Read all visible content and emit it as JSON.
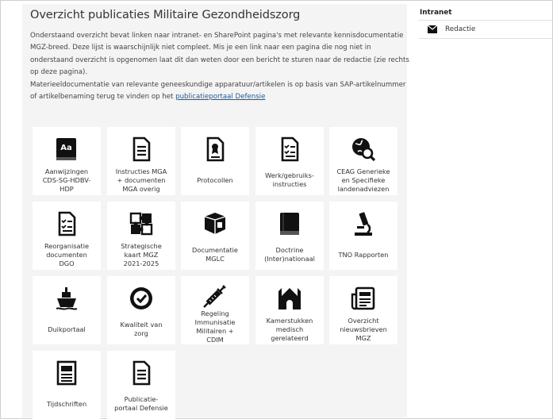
{
  "page": {
    "title": "Overzicht publicaties Militaire Gezondheidszorg",
    "intro_line1": "Onderstaand overzicht bevat linken naar intranet- en SharePoint pagina's met relevante kennisdocumentatie MGZ-breed. Deze lijst is waarschijnlijk niet compleet. Mis je een link naar een pagina die nog niet in onderstaand overzicht is opgenomen laat dit dan weten door een bericht te sturen naar de redactie (zie rechts op deze pagina).",
    "intro_line2": "Materieeldocumentatie van relevante geneeskundige apparatuur/artikelen is op basis van SAP-artikelnummer of artikelbenaming terug te vinden op het ",
    "intro_link": "publicatieportaal Defensie"
  },
  "tiles": [
    {
      "label": "Aanwijzingen\nCDS-SG-HDBV-\nHDP",
      "icon": "book-aa-icon"
    },
    {
      "label": "Instructies MGA\n+ documenten\nMGA overig",
      "icon": "document-icon"
    },
    {
      "label": "Protocollen",
      "icon": "certificate-document-icon"
    },
    {
      "label": "Werk/gebruiks-\ninstructies",
      "icon": "checklist-icon"
    },
    {
      "label": "CEAG Generieke\nen Specifieke\nlandenadviezen",
      "icon": "globe-search-icon"
    },
    {
      "label": "Reorganisatie\ndocumenten\nDGO",
      "icon": "checklist-document-icon"
    },
    {
      "label": "Strategische\nkaart MGZ\n2021-2025",
      "icon": "puzzle-icon"
    },
    {
      "label": "Documentatie\nMGLC",
      "icon": "cube-icon"
    },
    {
      "label": "Doctrine\n(Inter)nationaal",
      "icon": "book-icon"
    },
    {
      "label": "TNO Rapporten",
      "icon": "microscope-icon"
    },
    {
      "label": "Duikportaal",
      "icon": "ship-icon"
    },
    {
      "label": "Kwaliteit van\nzorg",
      "icon": "check-badge-icon"
    },
    {
      "label": "Regeling\nImmunisatie\nMilitairen +\nCDIM",
      "icon": "syringe-icon"
    },
    {
      "label": "Kamerstukken\nmedisch\ngerelateerd",
      "icon": "parliament-icon"
    },
    {
      "label": "Overzicht\nnieuwsbrieven\nMGZ",
      "icon": "newsletter-icon"
    },
    {
      "label": "Tijdschriften",
      "icon": "newspaper-icon"
    },
    {
      "label": "Publicatie-\nportaal Defensie",
      "icon": "document-list-icon"
    }
  ],
  "sidebar": {
    "heading": "Intranet",
    "items": [
      {
        "label": "Redactie",
        "icon": "envelope-icon"
      }
    ]
  }
}
